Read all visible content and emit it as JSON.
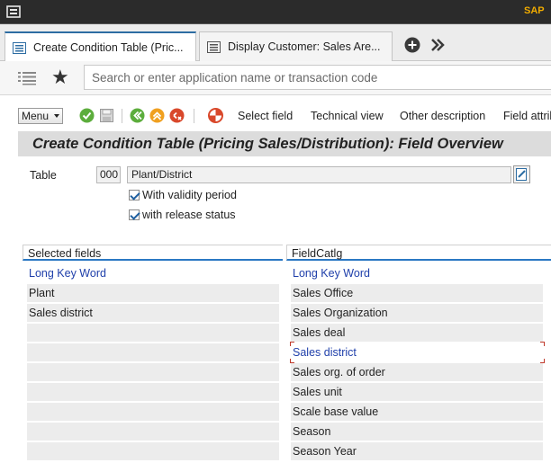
{
  "titlebar": {
    "brand": "SAP"
  },
  "tabs": [
    {
      "label": "Create Condition Table (Pric...",
      "active": true
    },
    {
      "label": "Display Customer: Sales Are...",
      "active": false
    }
  ],
  "command": {
    "placeholder": "Search or enter application name or transaction code"
  },
  "toolbar": {
    "menu_label": "Menu",
    "select_field": "Select field",
    "technical_view": "Technical view",
    "other_description": "Other description",
    "field_attrib": "Field attrib"
  },
  "page_title": "Create Condition Table (Pricing Sales/Distribution): Field Overview",
  "table": {
    "label": "Table",
    "number": "000",
    "description": "Plant/District"
  },
  "checkboxes": [
    {
      "label": "With validity period",
      "checked": true
    },
    {
      "label": "with release status",
      "checked": true
    }
  ],
  "selected_fields": {
    "header": "Selected fields",
    "column": "Long Key Word",
    "rows": [
      "Plant",
      "Sales district",
      "",
      "",
      "",
      "",
      "",
      "",
      ""
    ]
  },
  "field_catalog": {
    "header": "FieldCatlg",
    "column": "Long Key Word",
    "rows": [
      "Sales Office",
      "Sales Organization",
      "Sales deal",
      "Sales district",
      "Sales org. of order",
      "Sales unit",
      "Scale base value",
      "Season",
      "Season Year"
    ]
  },
  "colors": {
    "accent": "#2a78c4",
    "link": "#1f3faa",
    "brand": "#f0ab00"
  }
}
